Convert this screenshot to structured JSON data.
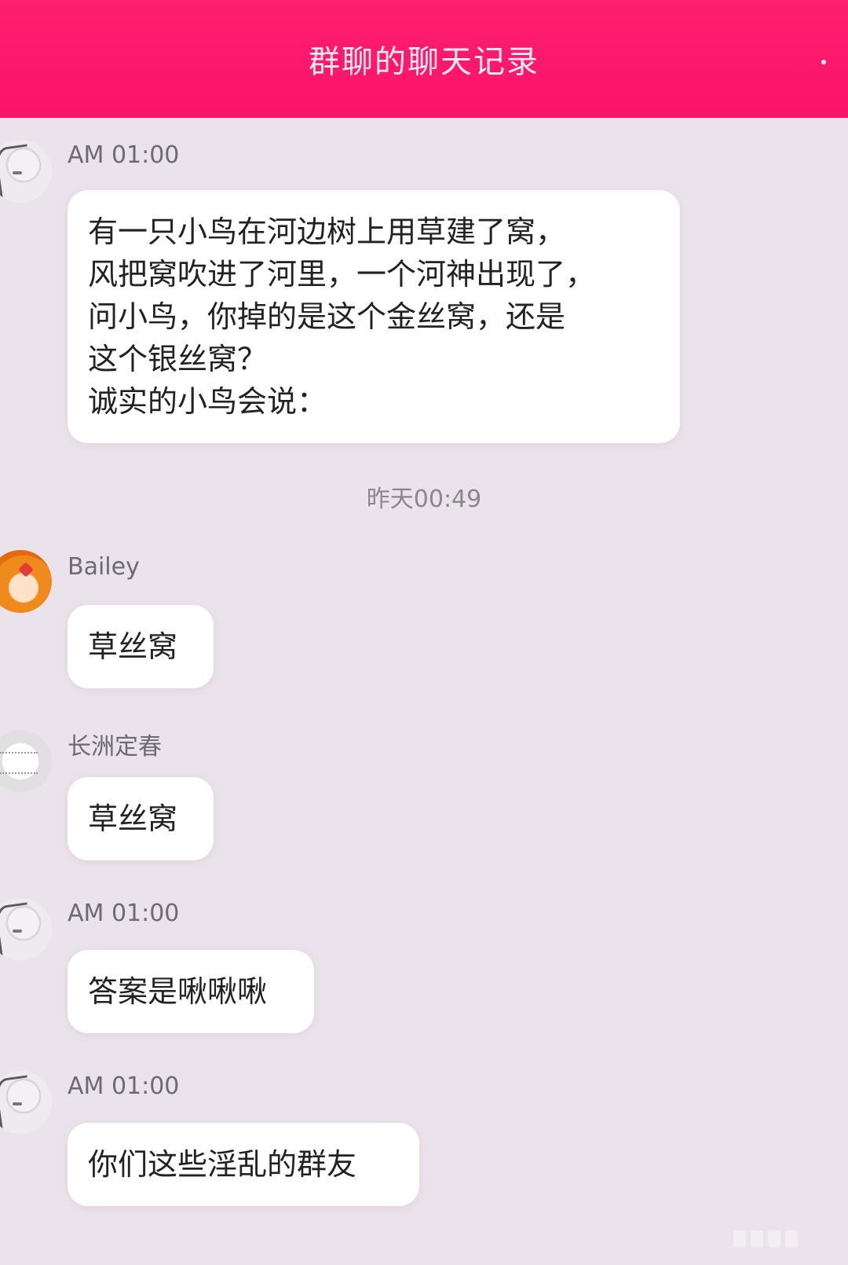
{
  "header": {
    "title": "群聊的聊天记录"
  },
  "messages": [
    {
      "sender": "AM 01:00",
      "avatar": "sketch-girl-avatar",
      "text": "有一只小鸟在河边树上用草建了窝，\n风把窝吹进了河里，一个河神出现了，\n问小鸟，你掉的是这个金丝窝，还是\n这个银丝窝？\n诚实的小鸟会说："
    },
    {
      "sender": "Bailey",
      "avatar": "orange-hair-avatar",
      "text": "草丝窝"
    },
    {
      "sender": "长洲定春",
      "avatar": "white-fluffy-avatar",
      "text": "草丝窝"
    },
    {
      "sender": "AM 01:00",
      "avatar": "sketch-girl-avatar",
      "text": "答案是啾啾啾"
    },
    {
      "sender": "AM 01:00",
      "avatar": "sketch-girl-avatar",
      "text": "你们这些淫乱的群友"
    }
  ],
  "timestamp": "昨天00:49",
  "colors": {
    "header": "#f9136a",
    "background": "#ebe3ec",
    "bubble": "#ffffff"
  }
}
